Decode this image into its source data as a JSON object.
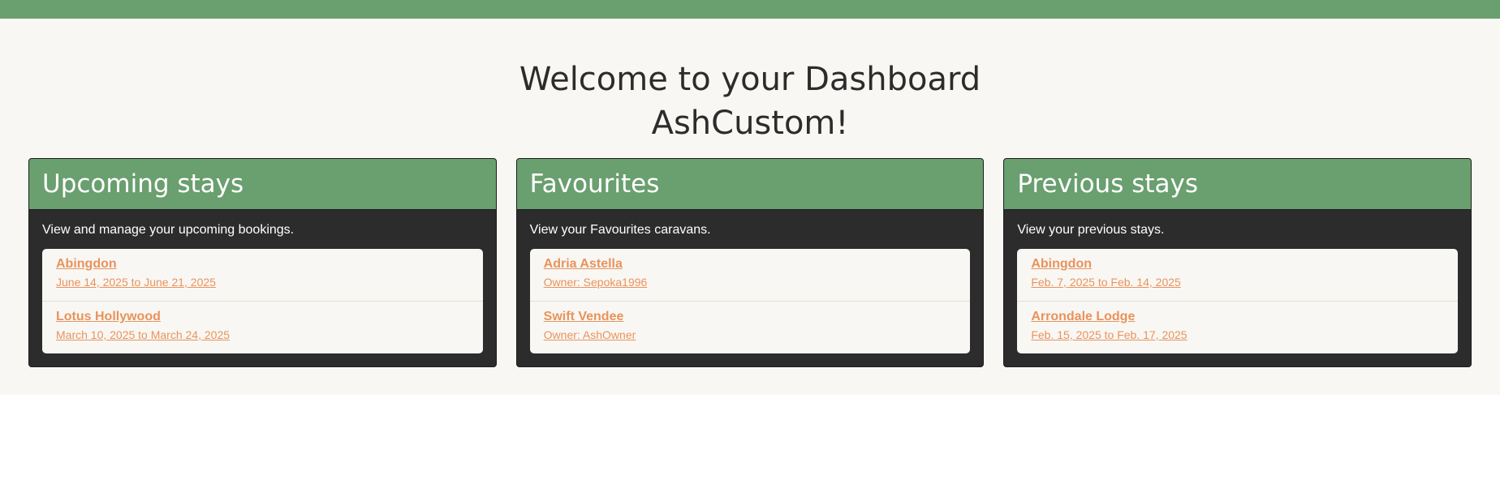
{
  "header": {
    "title_line1": "Welcome to your Dashboard",
    "title_line2": "AshCustom!"
  },
  "colors": {
    "accent_green": "#6a9f6f",
    "card_dark": "#2c2c2c",
    "link_orange": "#e9935b",
    "page_bg": "#f9f7f4"
  },
  "cards": [
    {
      "title": "Upcoming stays",
      "description": "View and manage your upcoming bookings.",
      "items": [
        {
          "title": "Abingdon",
          "subtitle": "June 14, 2025 to June 21, 2025"
        },
        {
          "title": "Lotus Hollywood",
          "subtitle": "March 10, 2025 to March 24, 2025"
        }
      ]
    },
    {
      "title": "Favourites",
      "description": "View your Favourites caravans.",
      "items": [
        {
          "title": "Adria Astella",
          "subtitle": "Owner: Sepoka1996"
        },
        {
          "title": "Swift Vendee",
          "subtitle": "Owner: AshOwner"
        }
      ]
    },
    {
      "title": "Previous stays",
      "description": "View your previous stays.",
      "items": [
        {
          "title": "Abingdon",
          "subtitle": "Feb. 7, 2025 to Feb. 14, 2025"
        },
        {
          "title": "Arrondale Lodge",
          "subtitle": "Feb. 15, 2025 to Feb. 17, 2025"
        }
      ]
    }
  ]
}
